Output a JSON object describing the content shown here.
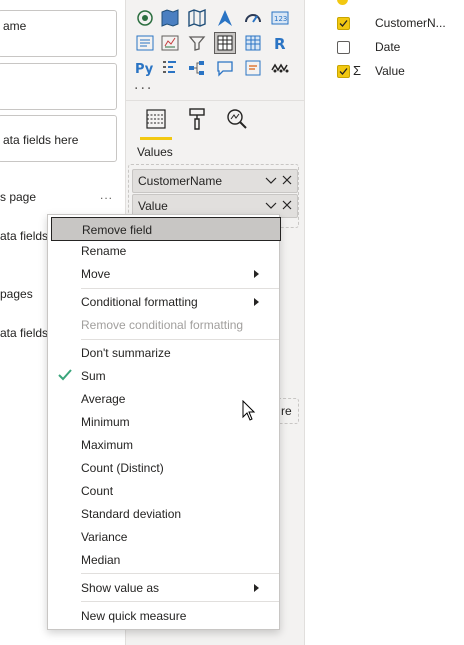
{
  "filters_pane": {
    "well1_text": "ame",
    "well3_text": "ata fields here",
    "page_label": "s page",
    "more": "...",
    "row2_text": "ata fields",
    "pages_label": "pages",
    "row3_text": "ata fields"
  },
  "viz_pane": {
    "more_visuals": "...",
    "values_label": "Values",
    "fields": [
      {
        "label": "CustomerName"
      },
      {
        "label": "Value"
      }
    ],
    "partial_text": "re",
    "tabs": [
      "fields-tab",
      "format-tab",
      "analytics-tab"
    ],
    "active_tab": "fields-tab",
    "accent": "#f2c811"
  },
  "fields_pane": {
    "items": [
      {
        "label": "CustomerN...",
        "checked": true,
        "sigma": ""
      },
      {
        "label": "Date",
        "checked": false,
        "sigma": ""
      },
      {
        "label": "Value",
        "checked": true,
        "sigma": "Σ"
      }
    ]
  },
  "context_menu": {
    "items": [
      {
        "label": "Remove field",
        "highlighted": true
      },
      {
        "label": "Rename"
      },
      {
        "label": "Move",
        "submenu": true
      },
      {
        "label": "Conditional formatting",
        "submenu": true
      },
      {
        "label": "Remove conditional formatting",
        "disabled": true
      },
      {
        "label": "Don't summarize"
      },
      {
        "label": "Sum",
        "checked": true
      },
      {
        "label": "Average"
      },
      {
        "label": "Minimum"
      },
      {
        "label": "Maximum"
      },
      {
        "label": "Count (Distinct)"
      },
      {
        "label": "Count"
      },
      {
        "label": "Standard deviation"
      },
      {
        "label": "Variance"
      },
      {
        "label": "Median"
      },
      {
        "label": "Show value as",
        "submenu": true
      },
      {
        "label": "New quick measure"
      }
    ]
  }
}
